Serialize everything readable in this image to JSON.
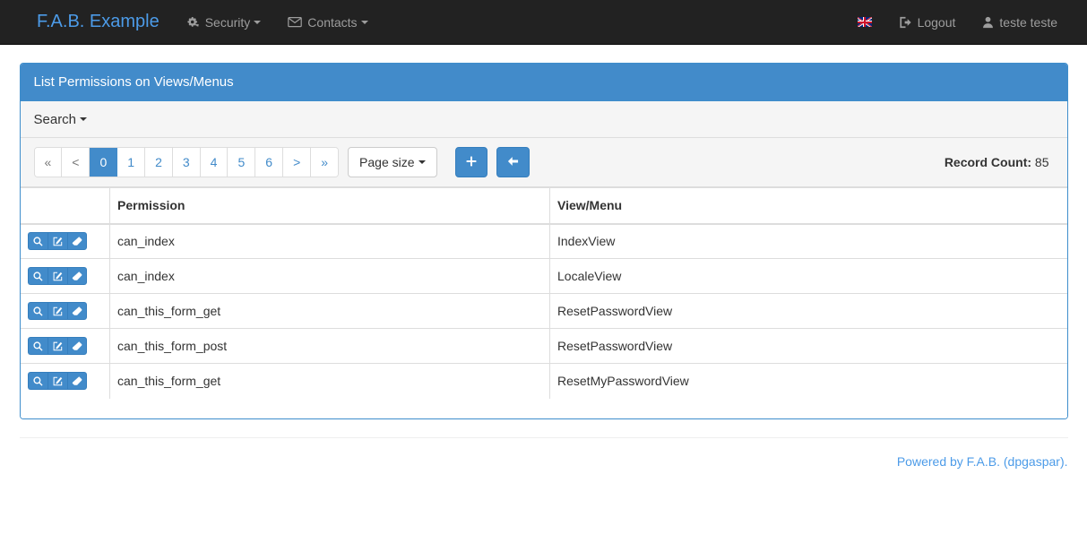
{
  "navbar": {
    "brand": "F.A.B. Example",
    "menus": [
      {
        "label": "Security",
        "icon": "cogs-icon"
      },
      {
        "label": "Contacts",
        "icon": "envelope-icon"
      }
    ],
    "language": {
      "icon": "uk-flag-icon",
      "label": ""
    },
    "logout": {
      "label": "Logout",
      "icon": "sign-out-icon"
    },
    "user": {
      "label": "teste teste",
      "icon": "user-icon"
    }
  },
  "panel": {
    "title": "List Permissions on Views/Menus"
  },
  "search": {
    "label": "Search"
  },
  "toolbar": {
    "pagination": [
      {
        "label": "«",
        "active": false,
        "muted": true
      },
      {
        "label": "<",
        "active": false,
        "muted": true
      },
      {
        "label": "0",
        "active": true,
        "muted": false
      },
      {
        "label": "1",
        "active": false,
        "muted": false
      },
      {
        "label": "2",
        "active": false,
        "muted": false
      },
      {
        "label": "3",
        "active": false,
        "muted": false
      },
      {
        "label": "4",
        "active": false,
        "muted": false
      },
      {
        "label": "5",
        "active": false,
        "muted": false
      },
      {
        "label": "6",
        "active": false,
        "muted": false
      },
      {
        "label": ">",
        "active": false,
        "muted": false
      },
      {
        "label": "»",
        "active": false,
        "muted": false
      }
    ],
    "page_size_label": "Page size",
    "add_button": {
      "label": "+",
      "icon": "plus-icon"
    },
    "back_button": {
      "label": "",
      "icon": "arrow-left-icon"
    },
    "record_count_label": "Record Count:",
    "record_count_value": "85"
  },
  "table": {
    "columns": [
      "",
      "Permission",
      "View/Menu"
    ],
    "row_actions": [
      {
        "name": "show-action",
        "icon": "magnifier-icon"
      },
      {
        "name": "edit-action",
        "icon": "pen-square-icon"
      },
      {
        "name": "delete-action",
        "icon": "eraser-icon"
      }
    ],
    "rows": [
      {
        "permission": "can_index",
        "view": "IndexView"
      },
      {
        "permission": "can_index",
        "view": "LocaleView"
      },
      {
        "permission": "can_this_form_get",
        "view": "ResetPasswordView"
      },
      {
        "permission": "can_this_form_post",
        "view": "ResetPasswordView"
      },
      {
        "permission": "can_this_form_get",
        "view": "ResetMyPasswordView"
      }
    ]
  },
  "footer": {
    "text": "Powered by F.A.B. (dpgaspar)."
  },
  "colors": {
    "navbar_bg": "#222222",
    "brand": "#4c9be8",
    "primary": "#428bca",
    "panel_border": "#3e8ecc",
    "toolbar_bg": "#f5f5f5",
    "border": "#dddddd",
    "link": "#4c9be8"
  }
}
